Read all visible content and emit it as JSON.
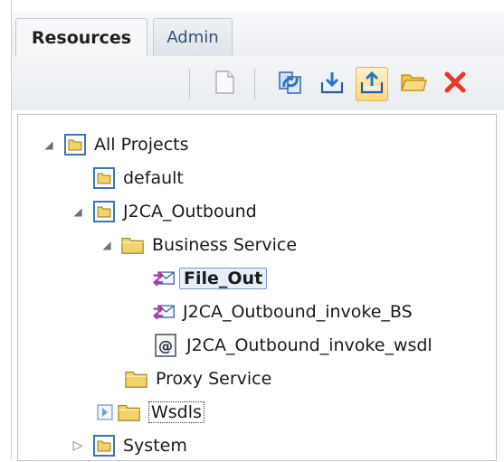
{
  "tabs": [
    {
      "label": "Resources"
    },
    {
      "label": "Admin"
    }
  ],
  "toolbar": {
    "buttons": [
      {
        "icon": "new-document-icon"
      },
      {
        "icon": "refresh-icon"
      },
      {
        "icon": "import-icon"
      },
      {
        "icon": "export-icon",
        "active": true
      },
      {
        "icon": "open-folder-icon"
      },
      {
        "icon": "delete-icon"
      }
    ]
  },
  "tree": {
    "nodes": [
      {
        "label": "All Projects"
      },
      {
        "label": "default"
      },
      {
        "label": "J2CA_Outbound"
      },
      {
        "label": "Business Service"
      },
      {
        "label": "File_Out"
      },
      {
        "label": "J2CA_Outbound_invoke_BS"
      },
      {
        "label": "J2CA_Outbound_invoke_wsdl"
      },
      {
        "label": "Proxy Service"
      },
      {
        "label": "Wsdls"
      },
      {
        "label": "System"
      }
    ]
  },
  "colors": {
    "selection_border": "#7d9bc2",
    "folder_yellow": "#f2d36b",
    "project_blue": "#3f74b8",
    "delete_red": "#e53a2a"
  }
}
